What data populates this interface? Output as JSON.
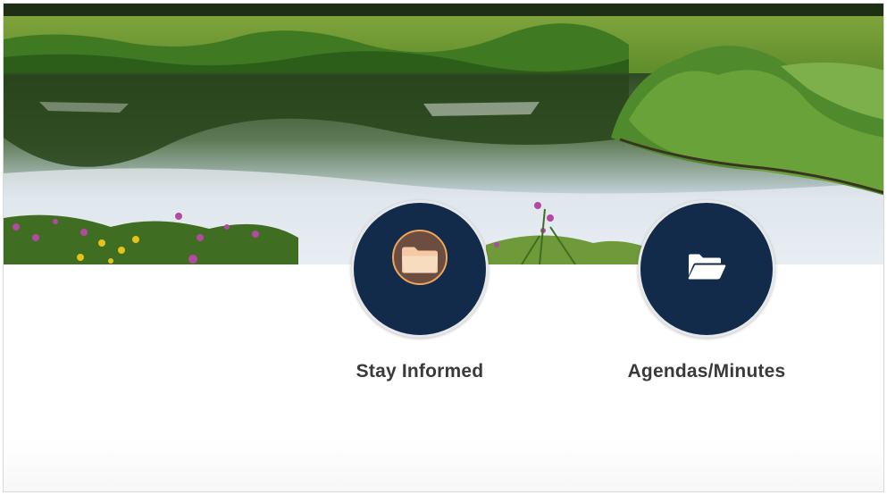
{
  "hero": {
    "image": "pond-with-wildflowers"
  },
  "quick_links": [
    {
      "label": "Stay Informed",
      "icon": "folder-icon",
      "state": "hover"
    },
    {
      "label": "Agendas/Minutes",
      "icon": "folder-open-icon",
      "state": "default"
    }
  ],
  "colors": {
    "circle": "#132b4a",
    "circle_border": "#e6e8ea",
    "hover_accent": "#f0a55a",
    "hover_fill": "#6b4e3f",
    "label_text": "#3a3a3a"
  }
}
